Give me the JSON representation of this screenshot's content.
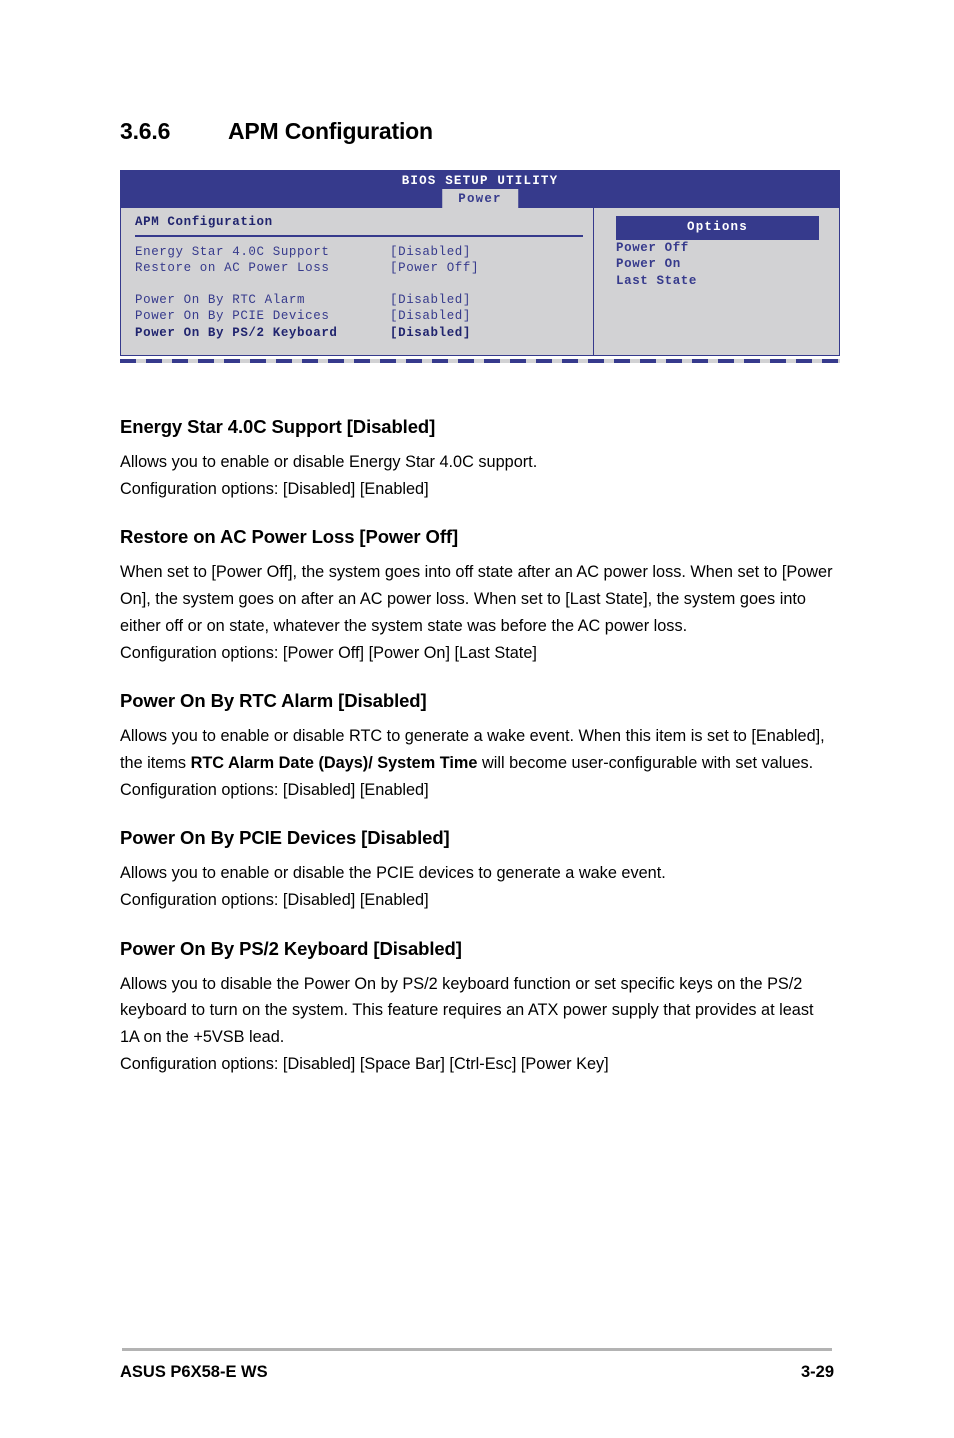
{
  "section": {
    "number": "3.6.6",
    "title": "APM Configuration"
  },
  "bios": {
    "utility_title": "BIOS SETUP UTILITY",
    "active_tab": "Power",
    "panel_title": "APM Configuration",
    "rows": [
      {
        "label": "Energy Star 4.0C Support",
        "value": "[Disabled]",
        "selected": false
      },
      {
        "label": "Restore on AC Power Loss",
        "value": "[Power Off]",
        "selected": false
      },
      {
        "label": "Power On By RTC Alarm",
        "value": "[Disabled]",
        "selected": false
      },
      {
        "label": "Power On By PCIE Devices",
        "value": "[Disabled]",
        "selected": false
      },
      {
        "label": "Power On By PS/2 Keyboard",
        "value": "[Disabled]",
        "selected": true
      }
    ],
    "options_header": "Options",
    "options": [
      "Power Off",
      "Power On",
      "Last State"
    ],
    "colors": {
      "header_blue": "#363a8c",
      "panel_gray": "#d2d2d4",
      "text_blue": "#363a8c"
    }
  },
  "items": [
    {
      "heading": "Energy Star 4.0C Support [Disabled]",
      "paragraphs": [
        {
          "runs": [
            {
              "text": "Allows you to enable or disable Energy Star 4.0C support.",
              "bold": false
            }
          ]
        },
        {
          "runs": [
            {
              "text": "Configuration options: [Disabled] [Enabled]",
              "bold": false
            }
          ]
        }
      ]
    },
    {
      "heading": "Restore on AC Power Loss [Power Off]",
      "paragraphs": [
        {
          "runs": [
            {
              "text": "When set to [Power Off], the system goes into off state after an AC power loss. When set to [Power On], the system goes on after an AC power loss. When set to [Last State], the system goes into either off or on state, whatever the system state was before the AC power loss.",
              "bold": false
            }
          ]
        },
        {
          "runs": [
            {
              "text": "Configuration options: [Power Off] [Power On] [Last State]",
              "bold": false
            }
          ]
        }
      ]
    },
    {
      "heading": "Power On By RTC Alarm [Disabled]",
      "paragraphs": [
        {
          "runs": [
            {
              "text": "Allows you to enable or disable RTC to generate a wake event. When this item is set to [Enabled], the items ",
              "bold": false
            },
            {
              "text": "RTC Alarm Date (Days)/ System Time",
              "bold": true
            },
            {
              "text": " will become user-configurable with set values. Configuration options: [Disabled] [Enabled]",
              "bold": false
            }
          ]
        }
      ]
    },
    {
      "heading": "Power On By PCIE Devices [Disabled]",
      "paragraphs": [
        {
          "runs": [
            {
              "text": "Allows you to enable or disable the PCIE devices to generate a wake event.",
              "bold": false
            }
          ]
        },
        {
          "runs": [
            {
              "text": "Configuration options: [Disabled] [Enabled]",
              "bold": false
            }
          ]
        }
      ]
    },
    {
      "heading": "Power On By PS/2 Keyboard [Disabled]",
      "paragraphs": [
        {
          "runs": [
            {
              "text": "Allows you to disable the Power On by PS/2 keyboard function or set specific keys on the PS/2 keyboard to turn on the system. This feature requires an ATX power supply that provides at least 1A on the +5VSB lead.",
              "bold": false
            }
          ]
        },
        {
          "runs": [
            {
              "text": "Configuration options: [Disabled] [Space Bar] [Ctrl-Esc] [Power Key]",
              "bold": false
            }
          ]
        }
      ]
    }
  ],
  "footer": {
    "product": "ASUS P6X58-E WS",
    "page": "3-29"
  }
}
